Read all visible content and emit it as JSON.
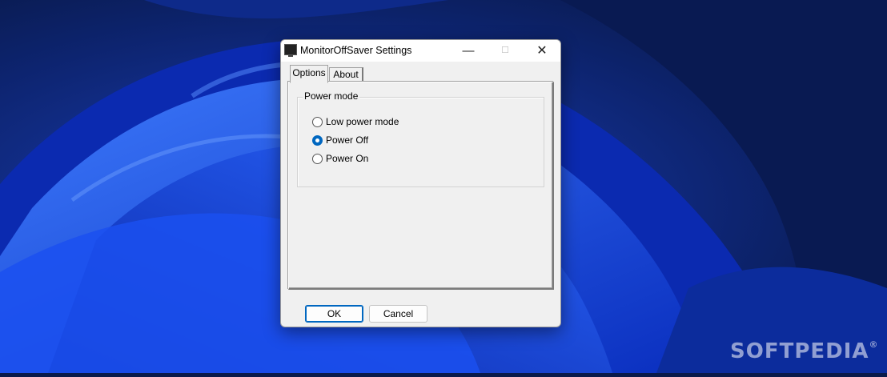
{
  "window": {
    "title": "MonitorOffSaver Settings",
    "minimize_symbol": "—",
    "maximize_symbol": "☐",
    "close_symbol": "✕"
  },
  "tabs": [
    {
      "label": "Options",
      "active": true
    },
    {
      "label": "About",
      "active": false
    }
  ],
  "power_mode": {
    "legend": "Power mode",
    "options": [
      {
        "label": "Low power mode",
        "checked": false
      },
      {
        "label": "Power Off",
        "checked": true
      },
      {
        "label": "Power On",
        "checked": false
      }
    ]
  },
  "buttons": {
    "ok": "OK",
    "cancel": "Cancel"
  },
  "watermark": {
    "text": "SOFTPEDIA",
    "mark": "®"
  },
  "colors": {
    "accent": "#0067c0",
    "dialog_bg": "#f0f0f0",
    "desktop_blue": "#1d4fe0"
  }
}
